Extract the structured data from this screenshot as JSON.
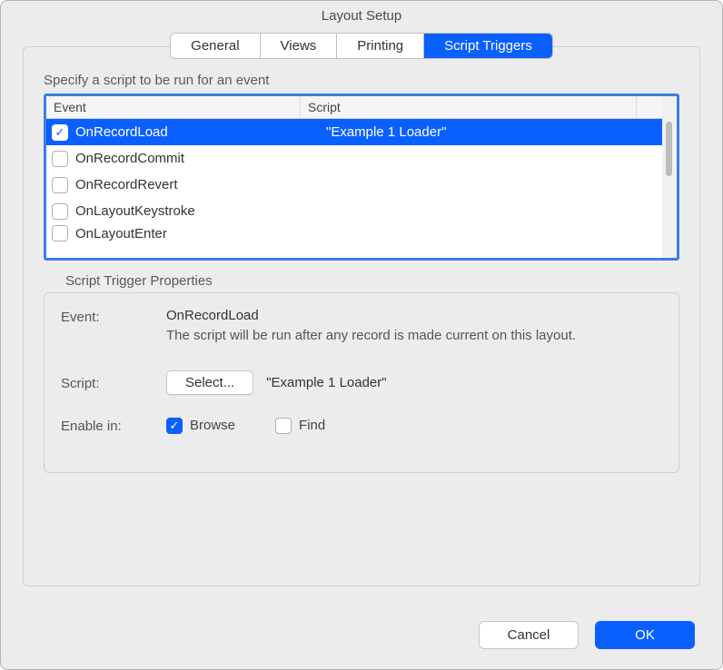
{
  "title": "Layout Setup",
  "tabs": [
    {
      "label": "General",
      "active": false
    },
    {
      "label": "Views",
      "active": false
    },
    {
      "label": "Printing",
      "active": false
    },
    {
      "label": "Script Triggers",
      "active": true
    }
  ],
  "section_label": "Specify a script to be run for an event",
  "table": {
    "headers": {
      "event": "Event",
      "script": "Script"
    },
    "rows": [
      {
        "checked": true,
        "selected": true,
        "event": "OnRecordLoad",
        "script": "\"Example 1 Loader\""
      },
      {
        "checked": false,
        "selected": false,
        "event": "OnRecordCommit",
        "script": ""
      },
      {
        "checked": false,
        "selected": false,
        "event": "OnRecordRevert",
        "script": ""
      },
      {
        "checked": false,
        "selected": false,
        "event": "OnLayoutKeystroke",
        "script": ""
      },
      {
        "checked": false,
        "selected": false,
        "event": "OnLayoutEnter",
        "script": ""
      }
    ]
  },
  "properties": {
    "title": "Script Trigger Properties",
    "event_label": "Event:",
    "event_name": "OnRecordLoad",
    "event_desc": "The script will be run after any record is made current on this layout.",
    "script_label": "Script:",
    "select_button": "Select...",
    "script_name": "\"Example 1 Loader\"",
    "enable_label": "Enable in:",
    "browse": {
      "label": "Browse",
      "checked": true
    },
    "find": {
      "label": "Find",
      "checked": false
    }
  },
  "footer": {
    "cancel": "Cancel",
    "ok": "OK"
  }
}
